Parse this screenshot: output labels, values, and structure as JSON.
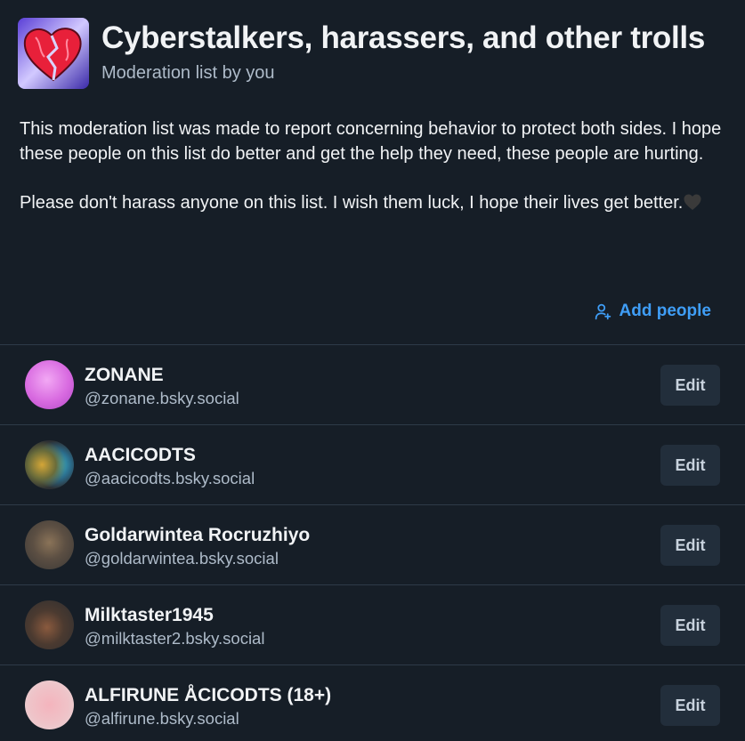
{
  "list": {
    "title": "Cyberstalkers, harassers, and other trolls",
    "subtitle": "Moderation list by you",
    "description_p1": "This moderation list was made to report concerning behavior to protect both sides. I hope these people on this list do better and get the help they need, these people are hurting.",
    "description_p2": "Please don't harass anyone on this list. I wish them luck, I hope their lives get better.",
    "avatar_icon": "broken-heart-image"
  },
  "actions": {
    "add_people_label": "Add people",
    "add_people_icon": "person-plus-icon",
    "accent_color": "#3f9ef7"
  },
  "members": [
    {
      "name": "ZONANE",
      "handle": "@zonane.bsky.social",
      "edit_label": "Edit"
    },
    {
      "name": "AACICODTS",
      "handle": "@aacicodts.bsky.social",
      "edit_label": "Edit"
    },
    {
      "name": "Goldarwintea Rocruzhiyo",
      "handle": "@goldarwintea.bsky.social",
      "edit_label": "Edit"
    },
    {
      "name": "Milktaster1945",
      "handle": "@milktaster2.bsky.social",
      "edit_label": "Edit"
    },
    {
      "name": "ALFIRUNE ÅCICODTS (18+)",
      "handle": "@alfirune.bsky.social",
      "edit_label": "Edit"
    }
  ]
}
